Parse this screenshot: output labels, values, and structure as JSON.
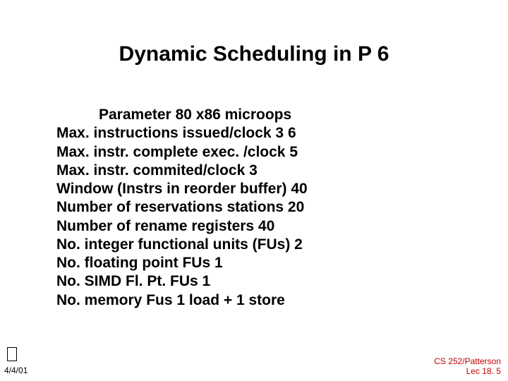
{
  "title": "Dynamic Scheduling in P 6",
  "header": "Parameter     80 x86 microops",
  "rows": [
    "Max. instructions issued/clock          3          6",
    "Max. instr. complete exec. /clock                    5",
    "Max. instr. commited/clock               3",
    "Window (Instrs in reorder buffer)                  40",
    "Number of reservations stations       20",
    "Number of rename registers  40",
    "No. integer functional units (FUs)      2",
    "No. floating point FUs           1",
    "No. SIMD Fl. Pt. FUs             1",
    "No. memory Fus                    1 load + 1 store"
  ],
  "date": "4/4/01",
  "footer_line1": "CS 252/Patterson",
  "footer_line2": "Lec 18. 5"
}
